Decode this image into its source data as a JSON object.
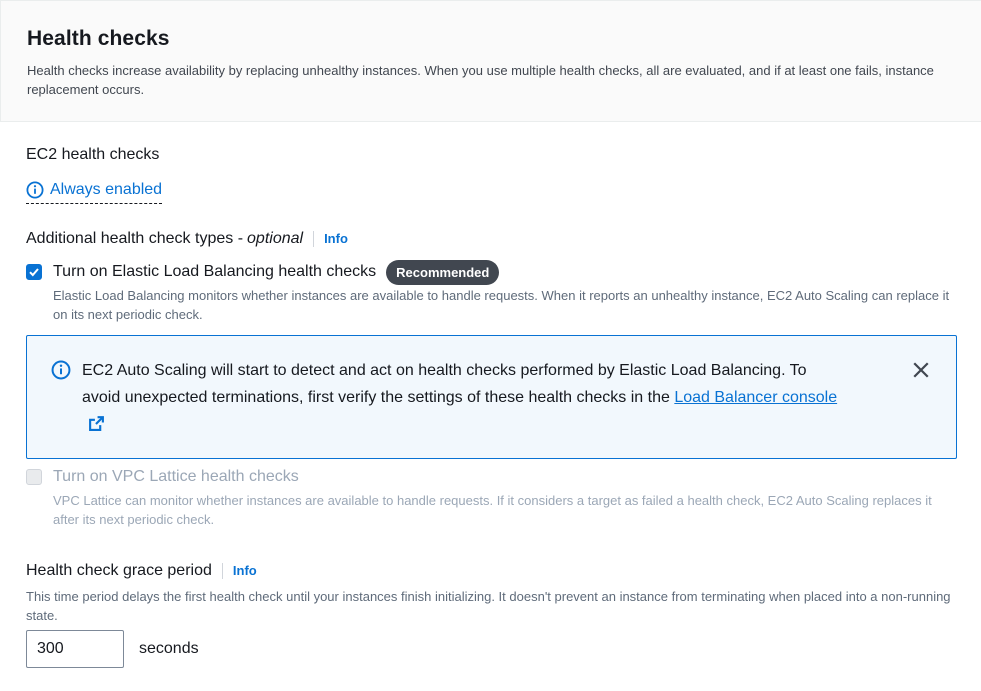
{
  "header": {
    "title": "Health checks",
    "description": "Health checks increase availability by replacing unhealthy instances. When you use multiple health checks, all are evaluated, and if at least one fails, instance replacement occurs."
  },
  "ec2": {
    "label": "EC2 health checks",
    "status": "Always enabled"
  },
  "additional": {
    "label_main": "Additional health check types - ",
    "label_optional": "optional",
    "info": "Info"
  },
  "elb": {
    "checked": true,
    "label": "Turn on Elastic Load Balancing health checks",
    "badge": "Recommended",
    "description": "Elastic Load Balancing monitors whether instances are available to handle requests. When it reports an unhealthy instance, EC2 Auto Scaling can replace it on its next periodic check."
  },
  "alert": {
    "text": "EC2 Auto Scaling will start to detect and act on health checks performed by Elastic Load Balancing. To avoid unexpected terminations, first verify the settings of these health checks in the ",
    "link": "Load Balancer console"
  },
  "vpc": {
    "checked": false,
    "disabled": true,
    "label": "Turn on VPC Lattice health checks",
    "description": "VPC Lattice can monitor whether instances are available to handle requests. If it considers a target as failed a health check, EC2 Auto Scaling replaces it after its next periodic check."
  },
  "grace": {
    "label": "Health check grace period",
    "info": "Info",
    "description": "This time period delays the first health check until your instances finish initializing. It doesn't prevent an instance from terminating when placed into a non-running state.",
    "value": "300",
    "unit": "seconds"
  },
  "colors": {
    "link": "#0972d3",
    "badge_bg": "#414750",
    "alert_bg": "#f2f8fd",
    "alert_border": "#0972d3"
  }
}
